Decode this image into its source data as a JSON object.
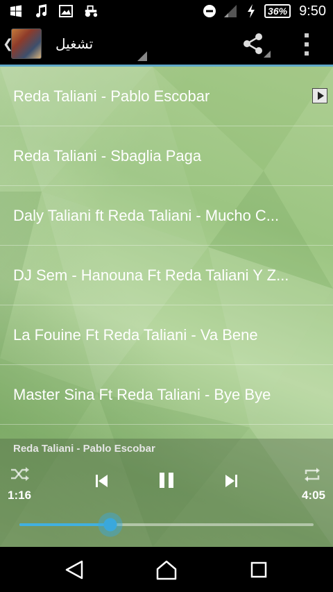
{
  "status_bar": {
    "icons_left": [
      "windows-icon",
      "music-note-icon",
      "image-icon",
      "tractor-icon"
    ],
    "icons_right": [
      "do-not-disturb-icon",
      "signal-icon",
      "charging-icon"
    ],
    "battery": "36%",
    "clock": "9:50"
  },
  "action_bar": {
    "title": "تشغيل"
  },
  "tracks": [
    {
      "title": "Reda Taliani - Pablo Escobar"
    },
    {
      "title": "Reda Taliani - Sbaglia Paga"
    },
    {
      "title": "Daly Taliani ft Reda Taliani - Mucho C..."
    },
    {
      "title": "DJ Sem - Hanouna Ft Reda Taliani Y Z..."
    },
    {
      "title": "La Fouine Ft Reda Taliani - Va Bene"
    },
    {
      "title": "Master Sina Ft Reda Taliani - Bye Bye"
    }
  ],
  "player": {
    "now_playing": "Reda Taliani - Pablo Escobar",
    "elapsed": "1:16",
    "duration": "4:05",
    "progress": 0.31
  },
  "colors": {
    "accent": "#41b0e0",
    "background": "#a6cb8c"
  }
}
